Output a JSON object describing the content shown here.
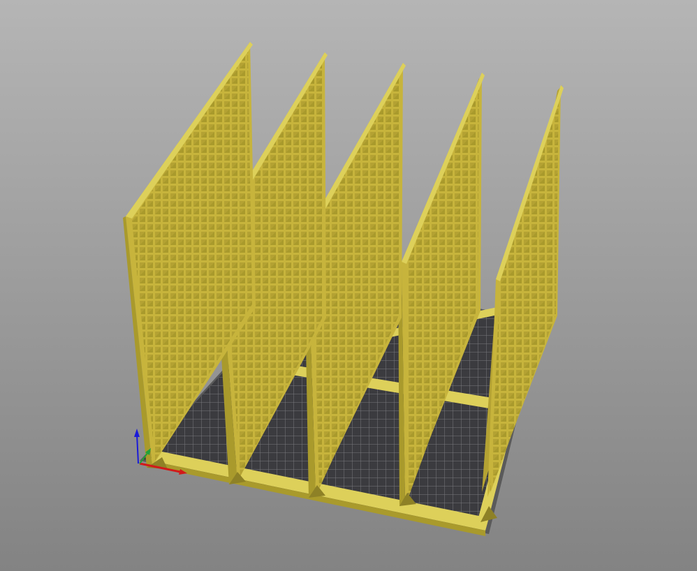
{
  "viewport": {
    "background_top": "#b5b5b5",
    "background_bottom": "#838383"
  },
  "bed": {
    "plate_color": "#3b3b3f",
    "grid_color": "#c8c8c8",
    "edge_color": "#5a5a5a"
  },
  "model": {
    "face_color": "#c7b43c",
    "top_color": "#ddd05a",
    "side_color": "#a99a2c",
    "shadow_color": "#8e8126",
    "rear_wall": "#b4a233",
    "divider_count": 5
  },
  "axes": {
    "x_color": "#d21a1a",
    "y_color": "#21a03a",
    "z_color": "#1a1ad8",
    "x_icon": "x-axis-arrow-icon",
    "y_icon": "y-axis-arrow-icon",
    "z_icon": "z-axis-arrow-icon"
  }
}
